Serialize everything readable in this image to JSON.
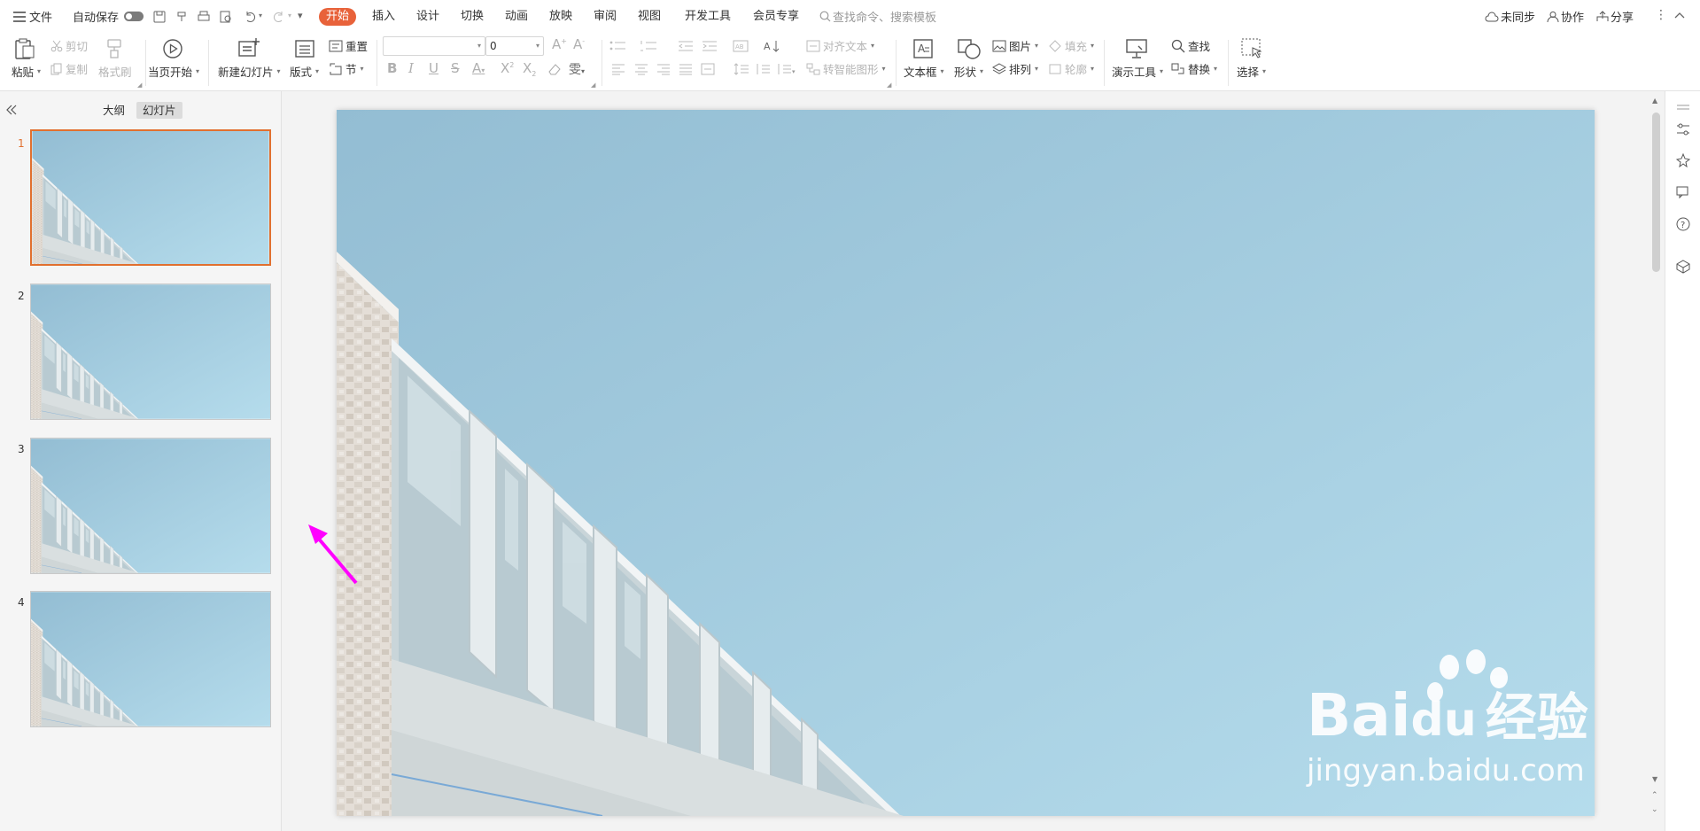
{
  "menu": {
    "file_label": "文件",
    "autosave_label": "自动保存",
    "tabs": [
      "开始",
      "插入",
      "设计",
      "切换",
      "动画",
      "放映",
      "审阅",
      "视图",
      "开发工具",
      "会员专享"
    ],
    "active_tab": "开始",
    "search_placeholder": "查找命令、搜索模板",
    "sync_label": "未同步",
    "collab_label": "协作",
    "share_label": "分享"
  },
  "ribbon": {
    "paste": "粘贴",
    "cut": "剪切",
    "copy": "复制",
    "format_painter": "格式刷",
    "play_from_current": "当页开始",
    "new_slide": "新建幻灯片",
    "layout": "版式",
    "reset": "重置",
    "section": "节",
    "font_size_value": "0",
    "align_text": "对齐文本",
    "smartart": "转智能图形",
    "textbox": "文本框",
    "shape": "形状",
    "picture": "图片",
    "arrange": "排列",
    "fill": "填充",
    "outline": "轮廓",
    "present_tools": "演示工具",
    "find": "查找",
    "replace": "替换",
    "select": "选择"
  },
  "panel": {
    "outline_tab": "大纲",
    "slides_tab": "幻灯片",
    "slide_numbers": [
      "1",
      "2",
      "3",
      "4"
    ],
    "selected_slide": "1"
  },
  "watermark": {
    "brand_left": "Bai",
    "brand_right": "du",
    "brand_cn": "经验",
    "url": "jingyan.baidu.com"
  },
  "colors": {
    "accent": "#e8623a",
    "selected_border": "#e1702f",
    "annotation_arrow": "#ff00ff",
    "sky": "#a9d0e3"
  }
}
